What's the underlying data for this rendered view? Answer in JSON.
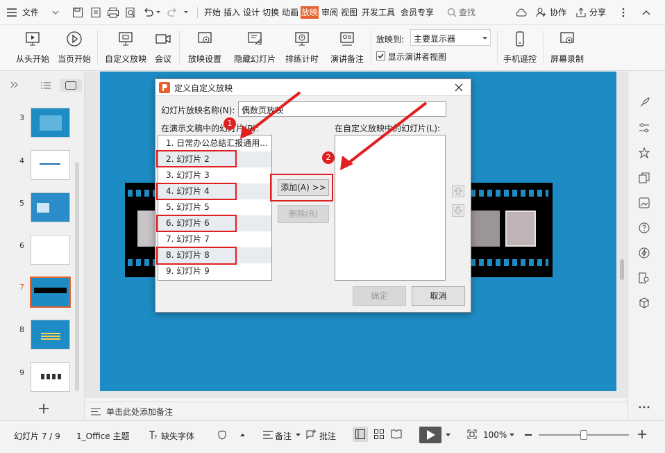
{
  "top_menu": {
    "file": "文件",
    "tabs": [
      "开始",
      "插入",
      "设计",
      "切换",
      "动画",
      "放映",
      "审阅",
      "视图",
      "开发工具",
      "会员专享"
    ],
    "active_tab": "放映",
    "search": "查找",
    "collab": "协作",
    "share": "分享"
  },
  "ribbon": {
    "from_start": "从头开始",
    "from_current": "当页开始",
    "custom_show": "自定义放映",
    "meeting": "会议",
    "show_settings": "放映设置",
    "hide_slide": "隐藏幻灯片",
    "rehearse": "排练计时",
    "speaker_notes": "演讲备注",
    "show_to_label": "放映到:",
    "show_to_value": "主要显示器",
    "presenter_view": "显示演讲者视图",
    "phone_remote": "手机遥控",
    "screen_record": "屏幕录制"
  },
  "thumbnails": [
    {
      "num": "3"
    },
    {
      "num": "4"
    },
    {
      "num": "5"
    },
    {
      "num": "6"
    },
    {
      "num": "7"
    },
    {
      "num": "8"
    },
    {
      "num": "9"
    }
  ],
  "selected_slide": "7",
  "dialog": {
    "title": "定义自定义放映",
    "name_label": "幻灯片放映名称(N):",
    "name_value": "偶数页放映",
    "left_label": "在演示文稿中的幻灯片(P):",
    "right_label": "在自定义放映中的幻灯片(L):",
    "slides": [
      "1. 日常办公总结汇报通用...",
      "2. 幻灯片 2",
      "3. 幻灯片 3",
      "4. 幻灯片 4",
      "5. 幻灯片 5",
      "6. 幻灯片 6",
      "7. 幻灯片 7",
      "8. 幻灯片 8",
      "9. 幻灯片 9"
    ],
    "add_btn": "添加(A) >>",
    "remove_btn": "删除(R)",
    "ok_btn": "确定",
    "cancel_btn": "取消"
  },
  "badges": [
    "1",
    "2"
  ],
  "notes_placeholder": "单击此处添加备注",
  "status": {
    "slide_info": "幻灯片 7 / 9",
    "theme": "1_Office 主题",
    "missing_font": "缺失字体",
    "notes": "备注",
    "comments": "批注",
    "zoom": "100%"
  },
  "colors": {
    "accent": "#e8612c",
    "slide_bg": "#1e8cc4",
    "annotation": "#e02020"
  }
}
